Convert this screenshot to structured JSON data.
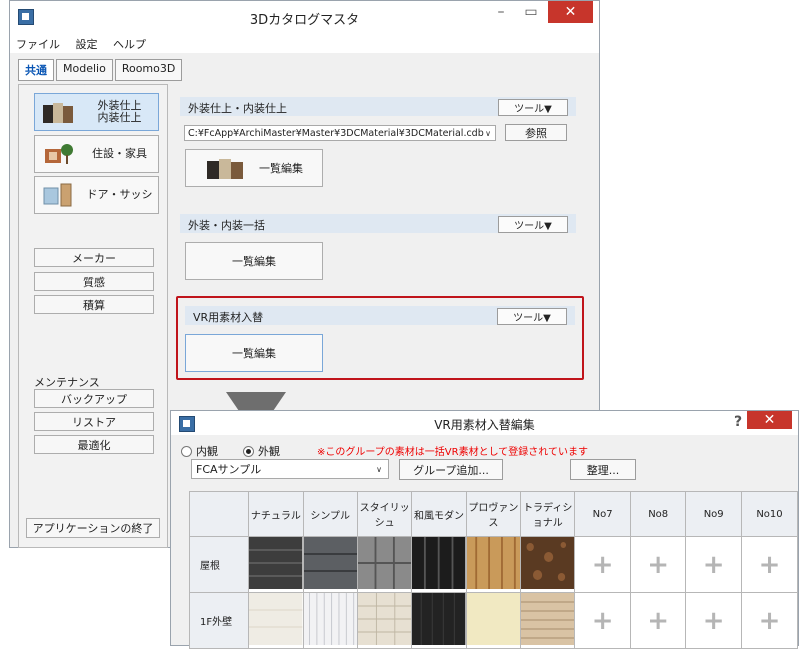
{
  "main_window": {
    "title": "3Dカタログマスタ",
    "menu": [
      "ファイル",
      "設定",
      "ヘルプ"
    ],
    "tabs": [
      "共通",
      "Modelio",
      "Roomo3D"
    ],
    "active_tab": "共通",
    "category_buttons": [
      {
        "label": "外装仕上\n内装仕上",
        "selected": true
      },
      {
        "label": "住設・家具",
        "selected": false
      },
      {
        "label": "ドア・サッシ",
        "selected": false
      }
    ],
    "master_buttons": [
      "メーカー",
      "質感",
      "積算"
    ],
    "maintenance_label": "メンテナンス",
    "maintenance_buttons": [
      "バックアップ",
      "リストア",
      "最適化"
    ],
    "exit_button": "アプリケーションの終了",
    "sections": [
      {
        "title": "外装仕上・内装仕上",
        "tool": "ツール▼",
        "edit": "一覧編集"
      },
      {
        "title": "外装・内装一括",
        "tool": "ツール▼",
        "edit": "一覧編集"
      },
      {
        "title": "VR用素材入替",
        "tool": "ツール▼",
        "edit": "一覧編集"
      }
    ],
    "path_value": "C:¥FcApp¥ArchiMaster¥Master¥3DCMaterial¥3DCMaterial.cdb",
    "browse_button": "参照"
  },
  "dialog": {
    "title": "VR用素材入替編集",
    "help": "?",
    "radio_interior": "内観",
    "radio_exterior": "外観",
    "selected_radio": "外観",
    "notice": "※このグループの素材は一括VR素材として登録されています",
    "group_value": "FCAサンプル",
    "add_group_button": "グループ追加...",
    "organize_button": "整理...",
    "columns": [
      "ナチュラル",
      "シンプル",
      "スタイリッシュ",
      "和風モダン",
      "プロヴァンス",
      "トラディショナル",
      "No7",
      "No8",
      "No9",
      "No10"
    ],
    "rows": [
      "屋根",
      "1F外壁"
    ]
  },
  "colors": {
    "accent": "#0b57b5",
    "highlight": "#c0141b",
    "close": "#c7352b",
    "notice": "#e00000"
  }
}
